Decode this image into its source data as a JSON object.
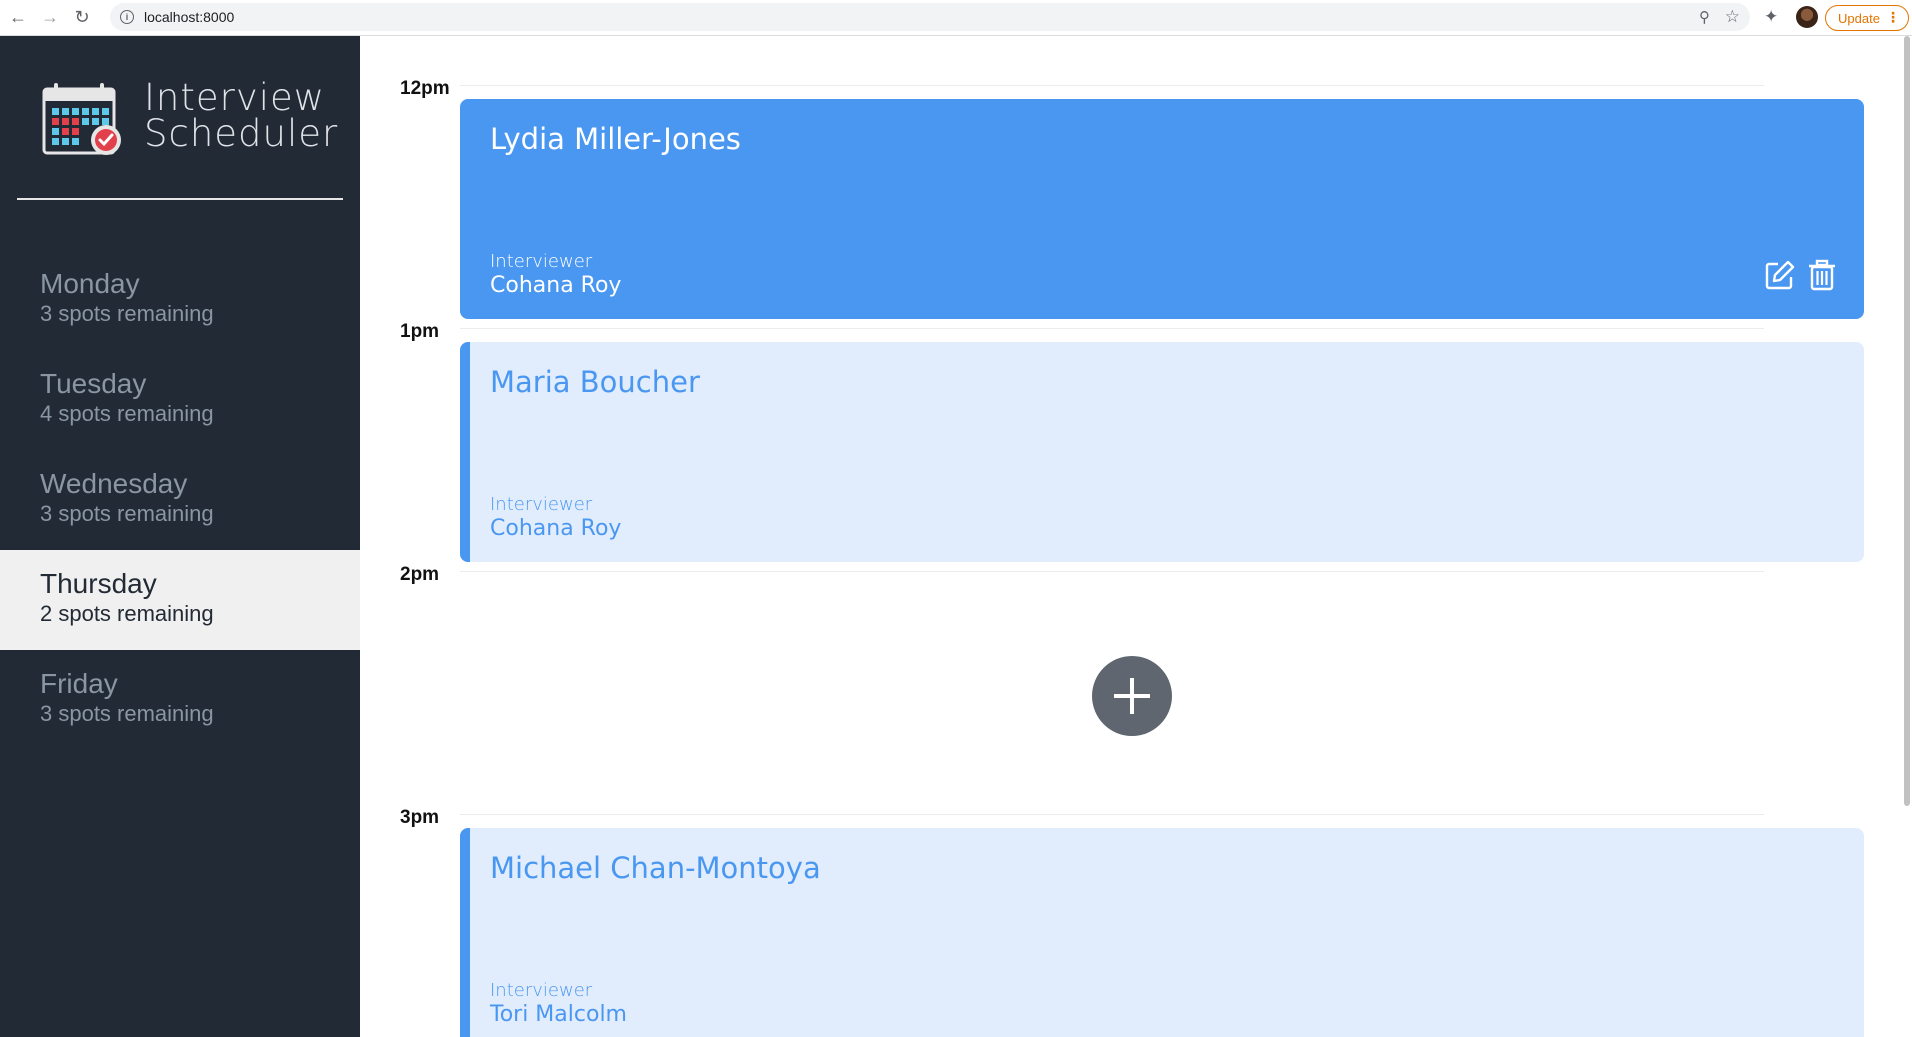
{
  "browser": {
    "url": "localhost:8000",
    "update_label": "Update",
    "icons": [
      "back-icon",
      "forward-icon",
      "reload-icon",
      "info-icon",
      "zoom-icon",
      "star-icon",
      "extensions-icon",
      "profile-avatar",
      "more-icon"
    ]
  },
  "brand": {
    "line1": "Interview",
    "line2": "Scheduler"
  },
  "days": [
    {
      "name": "Monday",
      "spots": "3 spots remaining",
      "selected": false
    },
    {
      "name": "Tuesday",
      "spots": "4 spots remaining",
      "selected": false
    },
    {
      "name": "Wednesday",
      "spots": "3 spots remaining",
      "selected": false
    },
    {
      "name": "Thursday",
      "spots": "2 spots remaining",
      "selected": true
    },
    {
      "name": "Friday",
      "spots": "3 spots remaining",
      "selected": false
    }
  ],
  "appointments": [
    {
      "time": "12pm",
      "student": "Lydia Miller-Jones",
      "interviewer_label": "Interviewer",
      "interviewer": "Cohana Roy",
      "state": "hover"
    },
    {
      "time": "1pm",
      "student": "Maria Boucher",
      "interviewer_label": "Interviewer",
      "interviewer": "Cohana Roy",
      "state": "show"
    },
    {
      "time": "2pm",
      "state": "empty"
    },
    {
      "time": "3pm",
      "student": "Michael Chan-Montoya",
      "interviewer_label": "Interviewer",
      "interviewer": "Tori Malcolm",
      "state": "show"
    }
  ],
  "colors": {
    "sidebar": "#222a35",
    "selected_day_bg": "#f0f0f0",
    "accent_blue": "#4a97f2",
    "card_light": "#e1edfc",
    "add_button": "#5f6670"
  }
}
